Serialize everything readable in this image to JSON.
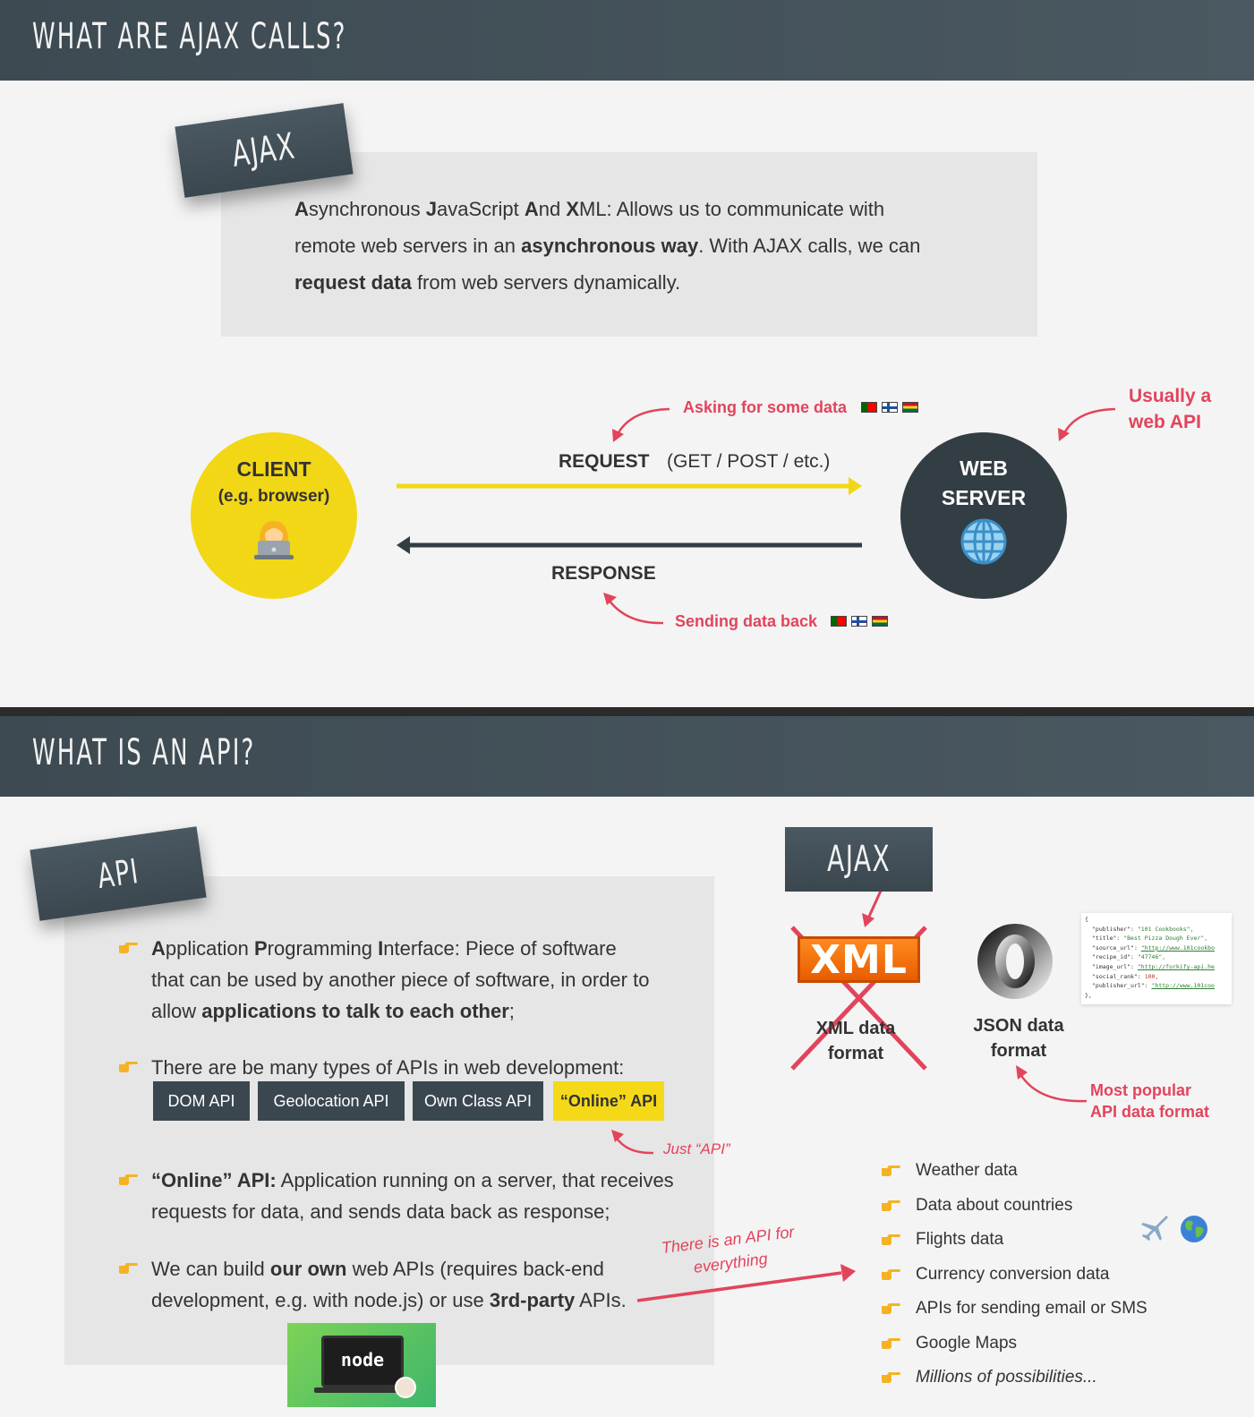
{
  "section1": {
    "title": "What are AJAX calls?",
    "tag": "AJAX",
    "definition": {
      "p1_prefix": "A",
      "p1_a": "synchronous ",
      "p1_b": "J",
      "p1_c": "avaScript ",
      "p1_d": "A",
      "p1_e": "nd ",
      "p1_f": "X",
      "p1_g": "ML: Allows us to communicate with",
      "p2_a": "remote web servers in an ",
      "p2_b": "asynchronous way",
      "p2_c": ". With AJAX calls, we can",
      "p3_a": "request data",
      "p3_b": " from web servers dynamically."
    }
  },
  "diagram": {
    "client_title": "CLIENT",
    "client_sub": "(e.g. browser)",
    "server_title_1": "WEB",
    "server_title_2": "SERVER",
    "request_label": "REQUEST",
    "request_methods": "(GET / POST / etc.)",
    "response_label": "RESPONSE",
    "note_asking": "Asking for some data",
    "note_sending": "Sending data back",
    "note_usually_1": "Usually a",
    "note_usually_2": "web API",
    "colors": {
      "yellow": "#f2d716",
      "dark": "#333d44",
      "red": "#e2445c"
    }
  },
  "section2": {
    "title": "What is an API?",
    "tag": "API",
    "bullets": {
      "b1_l1_a": "A",
      "b1_l1_b": "pplication ",
      "b1_l1_c": "P",
      "b1_l1_d": "rogramming ",
      "b1_l1_e": "I",
      "b1_l1_f": "nterface: Piece of software",
      "b1_l2": "that can be used by another piece of software, in order to",
      "b1_l3_a": "allow ",
      "b1_l3_b": "applications to talk to each other",
      "b1_l3_c": ";",
      "b2": "There are be many types of APIs in web development:",
      "b3_l1_a": "“Online” API:",
      "b3_l1_b": " Application running on a server, that receives",
      "b3_l2": "requests for data, and sends data back as response;",
      "b4_l1_a": "We can build ",
      "b4_l1_b": "our own",
      "b4_l1_c": " web APIs (requires back-end",
      "b4_l2_a": "development, e.g. with node.js) or use ",
      "b4_l2_b": "3rd-party",
      "b4_l2_c": " APIs."
    },
    "chips": [
      "DOM API",
      "Geolocation API",
      "Own Class API",
      "“Online” API"
    ],
    "note_just_api": "Just “API”",
    "note_everything_1": "There is an API for",
    "note_everything_2": "everything",
    "ajax_tag": "AJAX",
    "xml_logo": "XML",
    "xml_label_1": "XML data",
    "xml_label_2": "format",
    "json_label_1": "JSON data",
    "json_label_2": "format",
    "note_popular_1": "Most popular",
    "note_popular_2": "API data format",
    "node_logo": "node",
    "json_sample": [
      {
        "k": "\"publisher\"",
        "v": "\"101 Cookbooks\",",
        "t": "s"
      },
      {
        "k": "\"title\"",
        "v": "\"Best Pizza Dough Ever\",",
        "t": "s"
      },
      {
        "k": "\"source_url\"",
        "v": "\"http://www.101cookbo",
        "t": "u"
      },
      {
        "k": "\"recipe_id\"",
        "v": "\"47746\",",
        "t": "s"
      },
      {
        "k": "\"image_url\"",
        "v": "\"http://forkify-api.he",
        "t": "u"
      },
      {
        "k": "\"social_rank\"",
        "v": "100,",
        "t": "n"
      },
      {
        "k": "\"publisher_url\"",
        "v": "\"http://www.101coo",
        "t": "u"
      }
    ],
    "uses": [
      "Weather data",
      "Data about countries",
      "Flights data",
      "Currency conversion data",
      "APIs for sending email or SMS",
      "Google Maps",
      "Millions of possibilities..."
    ]
  }
}
